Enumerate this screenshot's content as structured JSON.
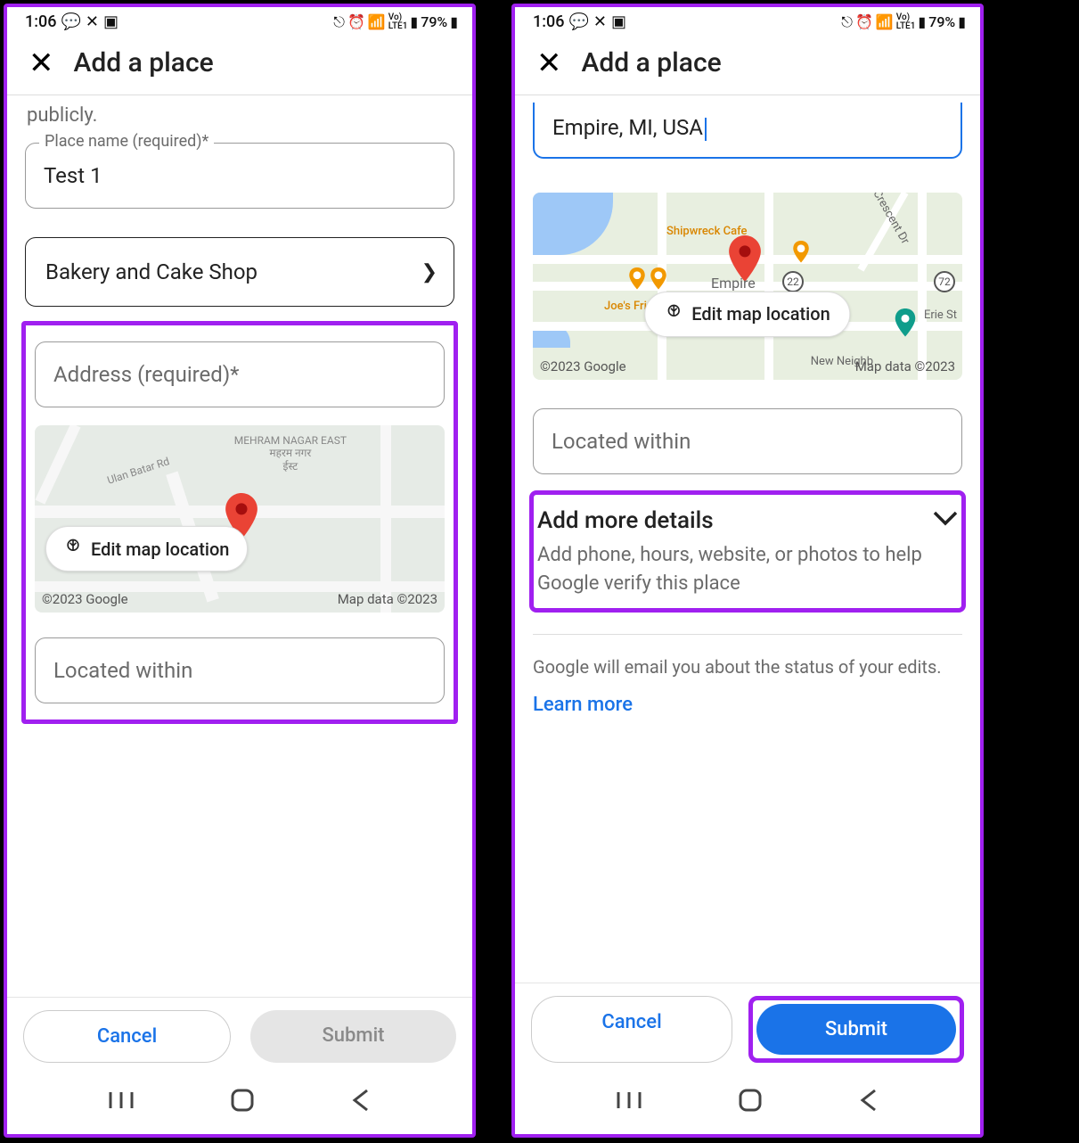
{
  "left": {
    "status": {
      "time": "1:06",
      "battery": "79%"
    },
    "header": {
      "title": "Add a place"
    },
    "partial_text": "publicly.",
    "place_name": {
      "label": "Place name (required)*",
      "value": "Test 1"
    },
    "category": {
      "value": "Bakery and Cake Shop"
    },
    "address": {
      "placeholder": "Address (required)*"
    },
    "map": {
      "edit_label": "Edit map location",
      "copyright": "©2023 Google",
      "data_label": "Map data ©2023",
      "area_label": "MEHRAM NAGAR EAST",
      "area_sub1": "महरम नगर",
      "area_sub2": "ईस्ट",
      "road_label": "Ulan Batar Rd"
    },
    "located_within": {
      "placeholder": "Located within"
    },
    "buttons": {
      "cancel": "Cancel",
      "submit": "Submit"
    }
  },
  "right": {
    "status": {
      "time": "1:06",
      "battery": "79%"
    },
    "header": {
      "title": "Add a place"
    },
    "address": {
      "value": "Empire, MI, USA"
    },
    "map": {
      "edit_label": "Edit map location",
      "copyright": "©2023 Google",
      "data_label": "Map data ©2023",
      "pois": {
        "shipwreck": "Shipwreck Cafe",
        "empire": "Empire",
        "joes": "Joe's Friendly Tavern",
        "newneigh": "New Neighb",
        "crescent": "Crescent Dr",
        "erie": "Erie St"
      },
      "route1": "22",
      "route2": "72"
    },
    "located_within": {
      "placeholder": "Located within"
    },
    "amd": {
      "title": "Add more details",
      "sub": "Add phone, hours, website, or photos to help Google verify this place"
    },
    "info": "Google will email you about the status of your edits.",
    "learn": "Learn more",
    "buttons": {
      "cancel": "Cancel",
      "submit": "Submit"
    }
  }
}
